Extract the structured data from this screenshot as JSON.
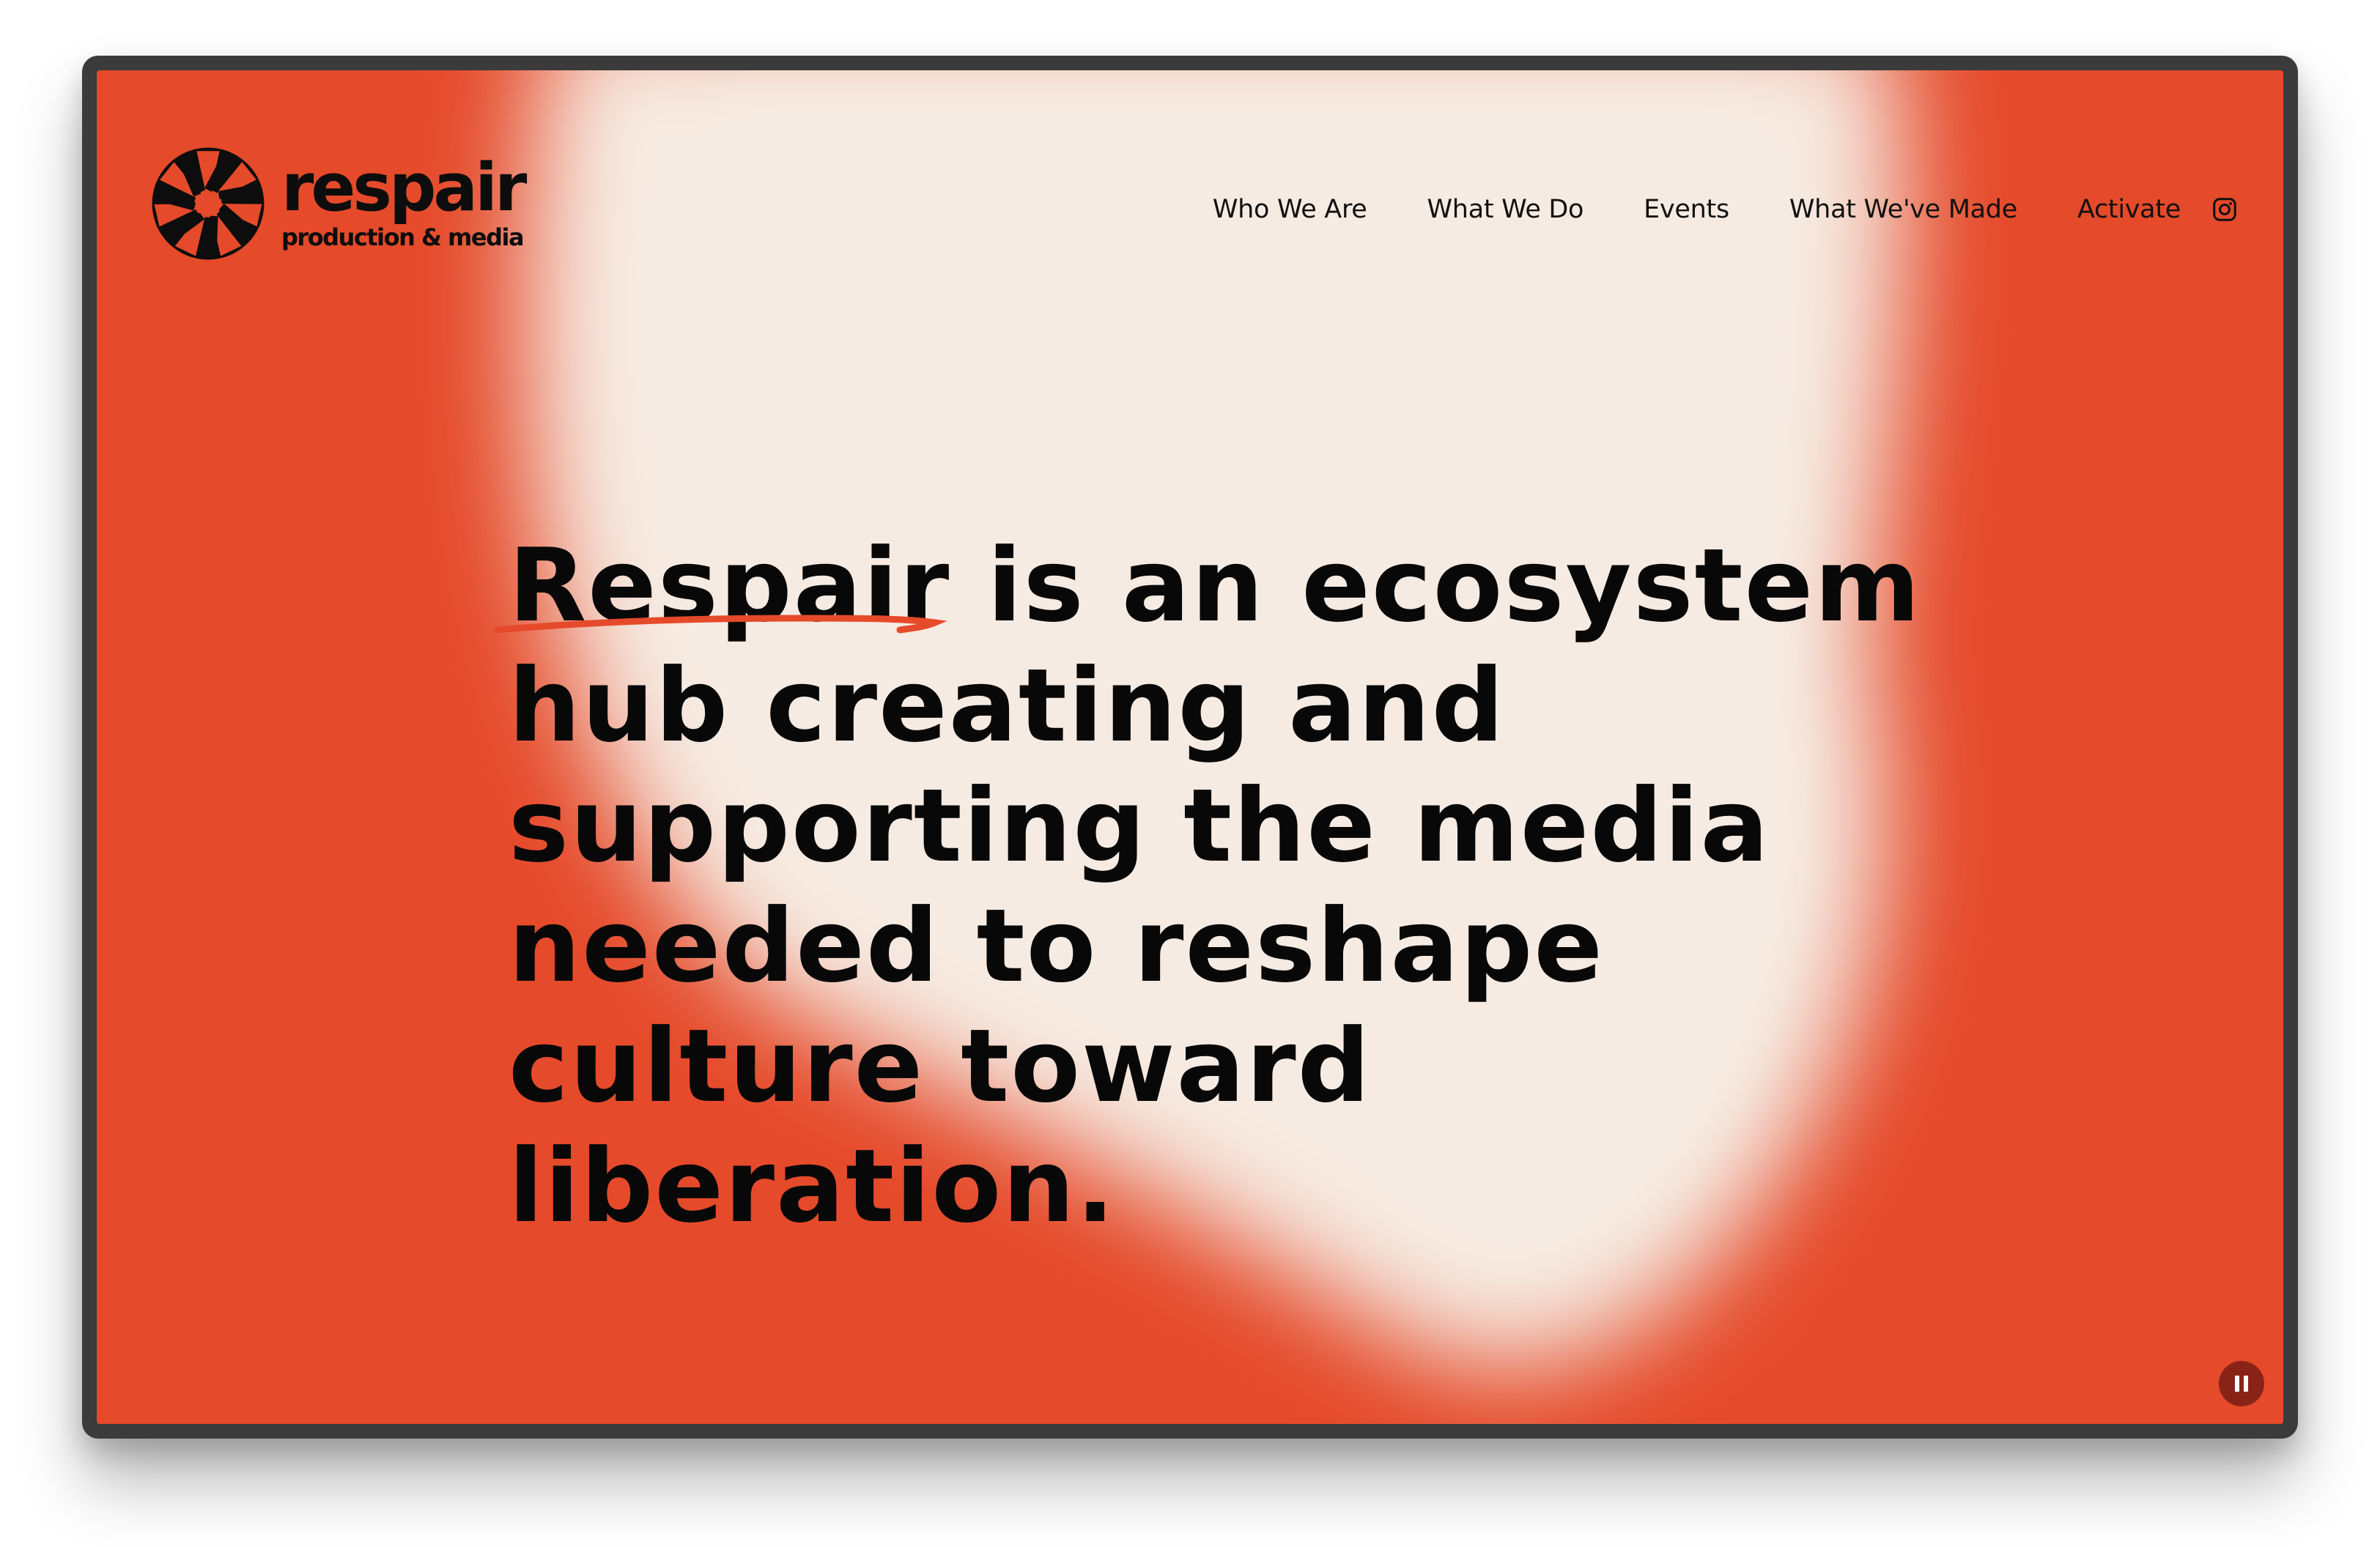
{
  "brand": {
    "name": "respair",
    "tagline": "production & media"
  },
  "nav": {
    "items": [
      {
        "label": "Who We Are"
      },
      {
        "label": "What We Do"
      },
      {
        "label": "Events"
      },
      {
        "label": "What We've Made"
      },
      {
        "label": "Activate"
      }
    ],
    "social_icon": "instagram-icon"
  },
  "hero": {
    "headline_lines": [
      "Respair is an ecosystem",
      "hub creating and",
      "supporting the media",
      "needed to reshape",
      "culture toward",
      "liberation."
    ],
    "underlined_word": "Respair",
    "line1_rest": " is an ecosystem"
  },
  "controls": {
    "pause_icon": "pause-icon"
  },
  "colors": {
    "background": "#e54a2a",
    "glow": "#f6ebe2",
    "text": "#080808",
    "underline": "#e54a2a",
    "pause_button": "#8a2317"
  }
}
